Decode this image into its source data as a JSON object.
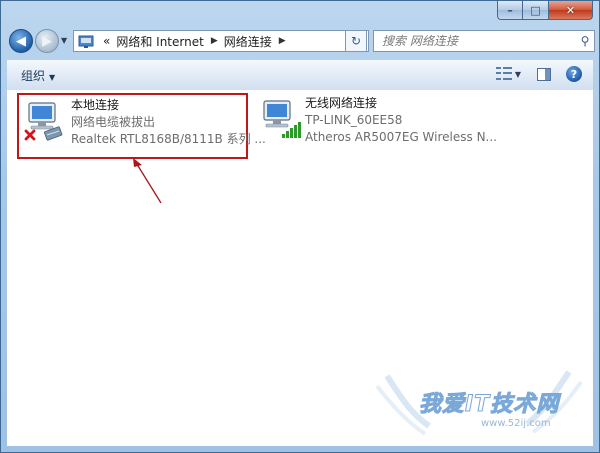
{
  "navigation": {
    "breadcrumb_prefix": "«",
    "crumbs": [
      "网络和 Internet",
      "网络连接"
    ]
  },
  "search": {
    "placeholder": "搜索 网络连接"
  },
  "toolbar": {
    "organize_label": "组织"
  },
  "connections": [
    {
      "name": "本地连接",
      "status": "网络电缆被拔出",
      "adapter": "Realtek RTL8168B/8111B 系列 ...",
      "icon": "wired-network-disconnected-icon"
    },
    {
      "name": "无线网络连接",
      "status": "TP-LINK_60EE58",
      "adapter": "Atheros AR5007EG Wireless N...",
      "icon": "wireless-network-connected-icon"
    }
  ],
  "watermark": {
    "text": "我爱IT技术网",
    "site": "www.52ij.com"
  },
  "colors": {
    "highlight_border": "#c0171b",
    "arrow": "#a21a1a",
    "window_frame": "#a8c8e8",
    "close_button": "#c0391b"
  }
}
